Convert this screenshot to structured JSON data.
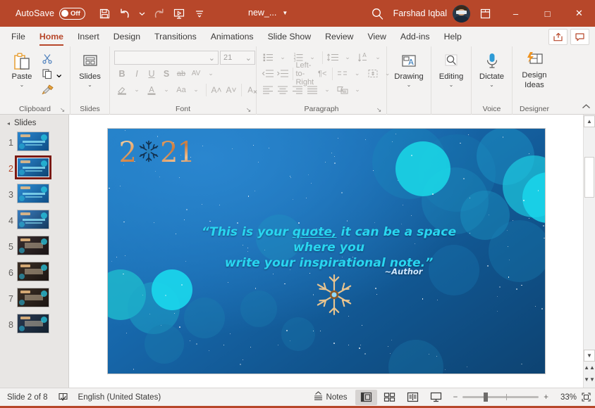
{
  "titlebar": {
    "autosave_label": "AutoSave",
    "autosave_state": "Off",
    "filename": "new_...",
    "username": "Farshad Iqbal",
    "quick_access": [
      {
        "name": "save-icon",
        "label": "Save"
      },
      {
        "name": "undo-icon",
        "label": "Undo"
      },
      {
        "name": "redo-icon",
        "label": "Redo"
      },
      {
        "name": "start-presentation-icon",
        "label": "Start From Beginning"
      },
      {
        "name": "customize-quick-access-icon",
        "label": "Customize Quick Access Toolbar"
      }
    ],
    "search_icon": "search-icon",
    "ribbon_display_icon": "ribbon-display-options-icon",
    "minimize": "–",
    "maximize": "□",
    "close": "✕",
    "accent_color": "#b7472a"
  },
  "tabs": [
    {
      "label": "File",
      "active": false
    },
    {
      "label": "Home",
      "active": true
    },
    {
      "label": "Insert",
      "active": false
    },
    {
      "label": "Design",
      "active": false
    },
    {
      "label": "Transitions",
      "active": false
    },
    {
      "label": "Animations",
      "active": false
    },
    {
      "label": "Slide Show",
      "active": false
    },
    {
      "label": "Review",
      "active": false
    },
    {
      "label": "View",
      "active": false
    },
    {
      "label": "Add-ins",
      "active": false
    },
    {
      "label": "Help",
      "active": false
    }
  ],
  "tab_actions": [
    {
      "name": "share-button",
      "label": "Share"
    },
    {
      "name": "comments-button",
      "label": "Comments"
    }
  ],
  "ribbon": {
    "clipboard": {
      "group_label": "Clipboard",
      "paste_label": "Paste",
      "paste_arrow": "⌄",
      "cut_label": "Cut",
      "copy_label": "Copy",
      "format_painter_label": "Format Painter",
      "dialog_launcher": "↘"
    },
    "slides": {
      "group_label": "Slides",
      "slides_label": "Slides",
      "slides_arrow": "⌄"
    },
    "font": {
      "group_label": "Font",
      "font_name_value": "",
      "font_size_value": "21",
      "bold": "B",
      "italic": "I",
      "underline": "U",
      "shadow": "S",
      "strikethrough": "ab",
      "character_spacing": "AV",
      "text_highlight": "Text Highlight Color",
      "font_color": "A",
      "change_case": "Aa",
      "increase_size": "A˄",
      "decrease_size": "A˅",
      "clear_formatting": "A",
      "dialog_launcher": "↘"
    },
    "paragraph": {
      "group_label": "Paragraph",
      "bullets": "Bullets",
      "numbering": "Numbering",
      "line_spacing": "Line Spacing",
      "text_direction": "Text Direction",
      "decrease_indent": "Decrease List Level",
      "increase_indent": "Increase List Level",
      "ltr": "Left-to-Right",
      "rtl": "Right-to-Left",
      "columns": "Columns",
      "align_text": "Align Text",
      "align_left": "Align Left",
      "align_center": "Center",
      "align_right": "Align Right",
      "justify": "Justify",
      "smartart": "Convert to SmartArt",
      "dialog_launcher": "↘"
    },
    "drawing": {
      "group_label": "",
      "label": "Drawing",
      "arrow": "⌄"
    },
    "editing": {
      "group_label": "",
      "label": "Editing",
      "arrow": "⌄"
    },
    "voice": {
      "group_label": "Voice",
      "label": "Dictate",
      "arrow": "⌄"
    },
    "designer": {
      "group_label": "Designer",
      "label_line1": "Design",
      "label_line2": "Ideas"
    },
    "collapse_ribbon_icon": "chevron-up-icon"
  },
  "thumbnails": {
    "header_label": "Slides",
    "collapse_icon": "triangle-collapse-icon",
    "items": [
      {
        "number": "1",
        "selected": false
      },
      {
        "number": "2",
        "selected": true
      },
      {
        "number": "3",
        "selected": false
      },
      {
        "number": "4",
        "selected": false
      },
      {
        "number": "5",
        "selected": false
      },
      {
        "number": "6",
        "selected": false
      },
      {
        "number": "7",
        "selected": false
      },
      {
        "number": "8",
        "selected": false
      }
    ]
  },
  "slide": {
    "year_left": "2",
    "year_right": "21",
    "snowflake_icon": "snowflake-icon",
    "quote_line1_a": "“This is your ",
    "quote_underlined": "quote,",
    "quote_line1_b": " it can be a space where you",
    "quote_line2": "write your inspirational note.”",
    "author": "~Author",
    "quote_color": "#29d6f0",
    "background_start": "#1f7ec4",
    "background_end": "#0d4372"
  },
  "scrollbar": {
    "up_icon": "scroll-up-icon",
    "down_icon": "scroll-down-icon",
    "previous_slide_icon": "previous-slide-icon",
    "next_slide_icon": "next-slide-icon"
  },
  "status": {
    "slide_counter": "Slide 2 of 8",
    "spellcheck_icon": "spellcheck-icon",
    "language": "English (United States)",
    "notes_label": "Notes",
    "notes_icon": "notes-icon",
    "views": [
      {
        "name": "normal-view-button",
        "label": "Normal",
        "active": true
      },
      {
        "name": "slide-sorter-view-button",
        "label": "Slide Sorter",
        "active": false
      },
      {
        "name": "reading-view-button",
        "label": "Reading View",
        "active": false
      },
      {
        "name": "slide-show-button",
        "label": "Slide Show",
        "active": false
      }
    ],
    "zoom_out": "−",
    "zoom_in": "+",
    "zoom_percent": "33%",
    "fit_icon": "fit-slide-to-window-icon"
  }
}
